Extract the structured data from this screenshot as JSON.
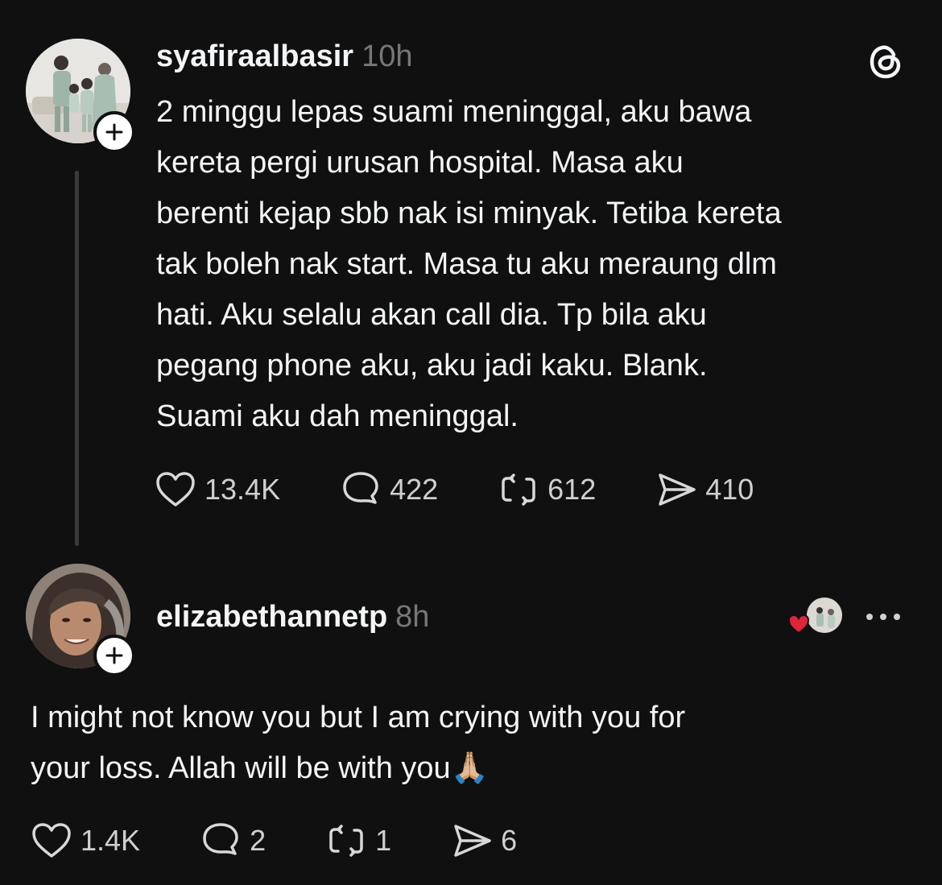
{
  "post": {
    "username": "syafiraalbasir",
    "time": "10h",
    "text": "2 minggu lepas suami meninggal, aku bawa\nkereta pergi urusan hospital. Masa aku\nberenti kejap sbb nak isi minyak. Tetiba kereta\ntak boleh nak start. Masa tu aku meraung dlm\nhati. Aku selalu akan call dia. Tp bila aku\npegang phone aku, aku jadi kaku. Blank.\nSuami aku dah meninggal.",
    "likes": "13.4K",
    "replies": "422",
    "reposts": "612",
    "shares": "410"
  },
  "reply": {
    "username": "elizabethannetp",
    "time": "8h",
    "text": "I might not know you but I am crying with you for\nyour loss. Allah will be with you",
    "emoji": "🙏🏼",
    "likes": "1.4K",
    "replies": "2",
    "reposts": "1",
    "shares": "6"
  },
  "icons": {
    "app_logo": "threads-logo-icon",
    "follow": "plus-icon",
    "like": "heart-outline-icon",
    "reply": "speech-bubble-icon",
    "repost": "repost-icon",
    "share": "send-icon",
    "more": "more-dots-icon",
    "author_liked": "red-heart-icon"
  },
  "colors": {
    "background": "#101010",
    "text": "#f3f5f7",
    "muted": "#777777",
    "like_red": "#e0243a"
  }
}
